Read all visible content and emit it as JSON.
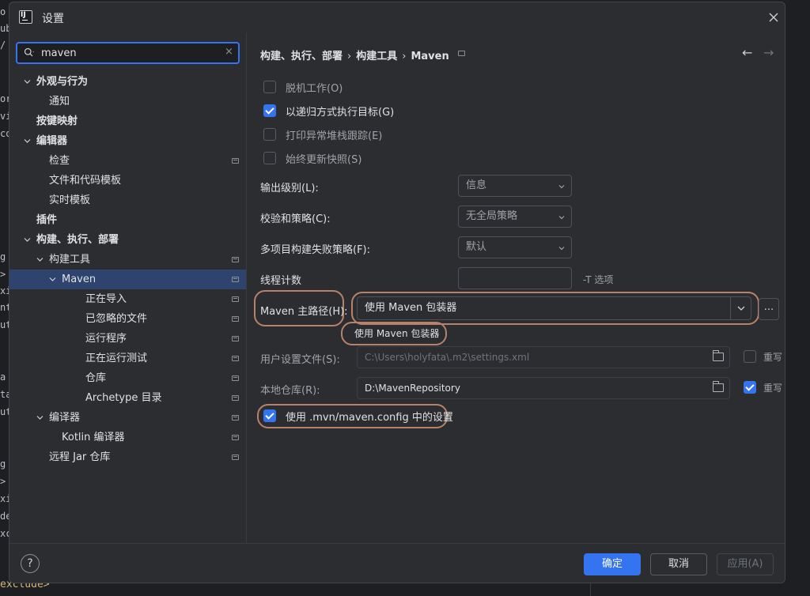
{
  "background": {
    "editor_lines": [
      "o",
      "ub",
      "/",
      "or",
      "vi",
      "co",
      "g",
      ">",
      "xi",
      "nt",
      "ut",
      "a",
      "ta",
      "ut",
      "g",
      ">",
      "xi",
      "de",
      "xc"
    ],
    "bottom_line": "exclude>"
  },
  "dialog": {
    "title": "设置"
  },
  "search": {
    "value": "maven",
    "clear": "×"
  },
  "tree": [
    {
      "label": "外观与行为",
      "level": 1,
      "bold": true,
      "expanded": true
    },
    {
      "label": "通知",
      "level": 2
    },
    {
      "label": "按键映射",
      "level": 1,
      "bold": true
    },
    {
      "label": "编辑器",
      "level": 1,
      "bold": true,
      "expanded": true
    },
    {
      "label": "检查",
      "level": 2,
      "pin": true
    },
    {
      "label": "文件和代码模板",
      "level": 2
    },
    {
      "label": "实时模板",
      "level": 2
    },
    {
      "label": "插件",
      "level": 1,
      "bold": true
    },
    {
      "label": "构建、执行、部署",
      "level": 1,
      "bold": true,
      "expanded": true
    },
    {
      "label": "构建工具",
      "level": 2,
      "pin": true,
      "expanded": true
    },
    {
      "label": "Maven",
      "level": 3,
      "pin": true,
      "expanded": true,
      "selected": true
    },
    {
      "label": "正在导入",
      "level": 4,
      "pin": true
    },
    {
      "label": "已忽略的文件",
      "level": 4,
      "pin": true
    },
    {
      "label": "运行程序",
      "level": 4,
      "pin": true
    },
    {
      "label": "正在运行测试",
      "level": 4,
      "pin": true
    },
    {
      "label": "仓库",
      "level": 4,
      "pin": true
    },
    {
      "label": "Archetype 目录",
      "level": 4,
      "pin": true
    },
    {
      "label": "编译器",
      "level": 2,
      "pin": true,
      "expanded": true
    },
    {
      "label": "Kotlin 编译器",
      "level": 3,
      "pin": true
    },
    {
      "label": "远程 Jar 仓库",
      "level": 2,
      "pin": true
    }
  ],
  "breadcrumb": {
    "items": [
      "构建、执行、部署",
      "构建工具",
      "Maven"
    ],
    "separator": "›"
  },
  "nav": {
    "back": "←",
    "forward": "→"
  },
  "checkboxes": [
    {
      "label": "脱机工作(O)",
      "checked": false
    },
    {
      "label": "以递归方式执行目标(G)",
      "checked": true
    },
    {
      "label": "打印异常堆栈跟踪(E)",
      "checked": false
    },
    {
      "label": "始终更新快照(S)",
      "checked": false
    }
  ],
  "fields": {
    "output_level": {
      "label": "输出级别(L):",
      "value": "信息"
    },
    "checksum_policy": {
      "label": "校验和策略(C):",
      "value": "无全局策略"
    },
    "multiproject_fail": {
      "label": "多项目构建失败策略(F):",
      "value": "默认"
    },
    "thread_count": {
      "label": "线程计数",
      "value": "",
      "hint": "-T 选项"
    },
    "maven_home": {
      "label": "Maven 主路径(H):",
      "value": "使用 Maven 包装器",
      "browse": "...",
      "tooltip": "使用 Maven 包装器"
    },
    "user_settings": {
      "label": "用户设置文件(S):",
      "value": "C:\\Users\\holyfata\\.m2\\settings.xml",
      "override_label": "重写",
      "override": false
    },
    "local_repo": {
      "label": "本地仓库(R):",
      "value": "D:\\MavenRepository",
      "override_label": "重写",
      "override": true
    }
  },
  "use_mvn_config": {
    "label": "使用 .mvn/maven.config 中的设置",
    "checked": true
  },
  "footer": {
    "help": "?",
    "ok": "确定",
    "cancel": "取消",
    "apply": "应用(A)"
  },
  "colors": {
    "accent": "#3574f0",
    "highlight": "#b8826a",
    "selection": "#2e436e"
  }
}
